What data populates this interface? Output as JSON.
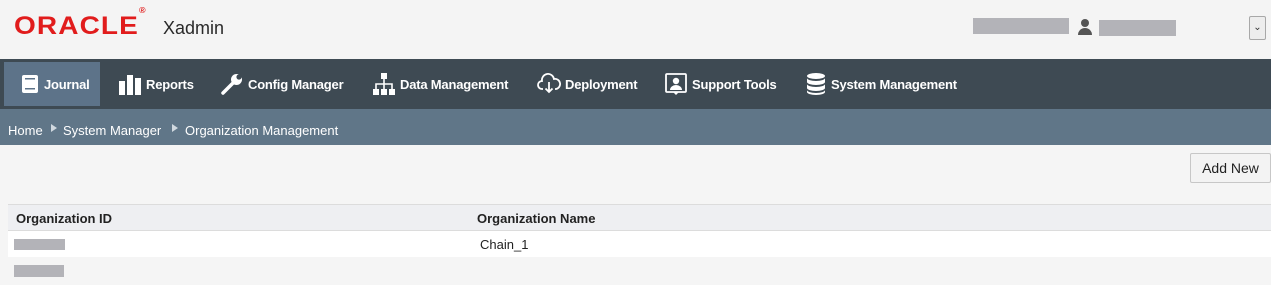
{
  "header": {
    "logo": "ORACLE",
    "logo_mark": "®",
    "app_name": "Xadmin",
    "user_menu_icon": "chevron-down-icon"
  },
  "nav": {
    "items": [
      {
        "label": "Journal",
        "icon": "journal-icon",
        "active": true
      },
      {
        "label": "Reports",
        "icon": "bar-chart-icon"
      },
      {
        "label": "Config Manager",
        "icon": "wrench-icon"
      },
      {
        "label": "Data Management",
        "icon": "hierarchy-icon"
      },
      {
        "label": "Deployment",
        "icon": "cloud-download-icon"
      },
      {
        "label": "Support Tools",
        "icon": "support-icon"
      },
      {
        "label": "System Management",
        "icon": "database-icon"
      }
    ]
  },
  "breadcrumb": {
    "items": [
      "Home",
      "System Manager",
      "Organization Management"
    ]
  },
  "toolbar": {
    "add_new_label": "Add New"
  },
  "table": {
    "columns": [
      "Organization ID",
      "Organization Name"
    ],
    "rows": [
      {
        "organization_name": "Chain_1"
      }
    ]
  },
  "colors": {
    "brand": "#e11c1c",
    "nav_bg": "#3e4a53",
    "nav_active": "#5d7389",
    "breadcrumb_bg": "#607688"
  }
}
